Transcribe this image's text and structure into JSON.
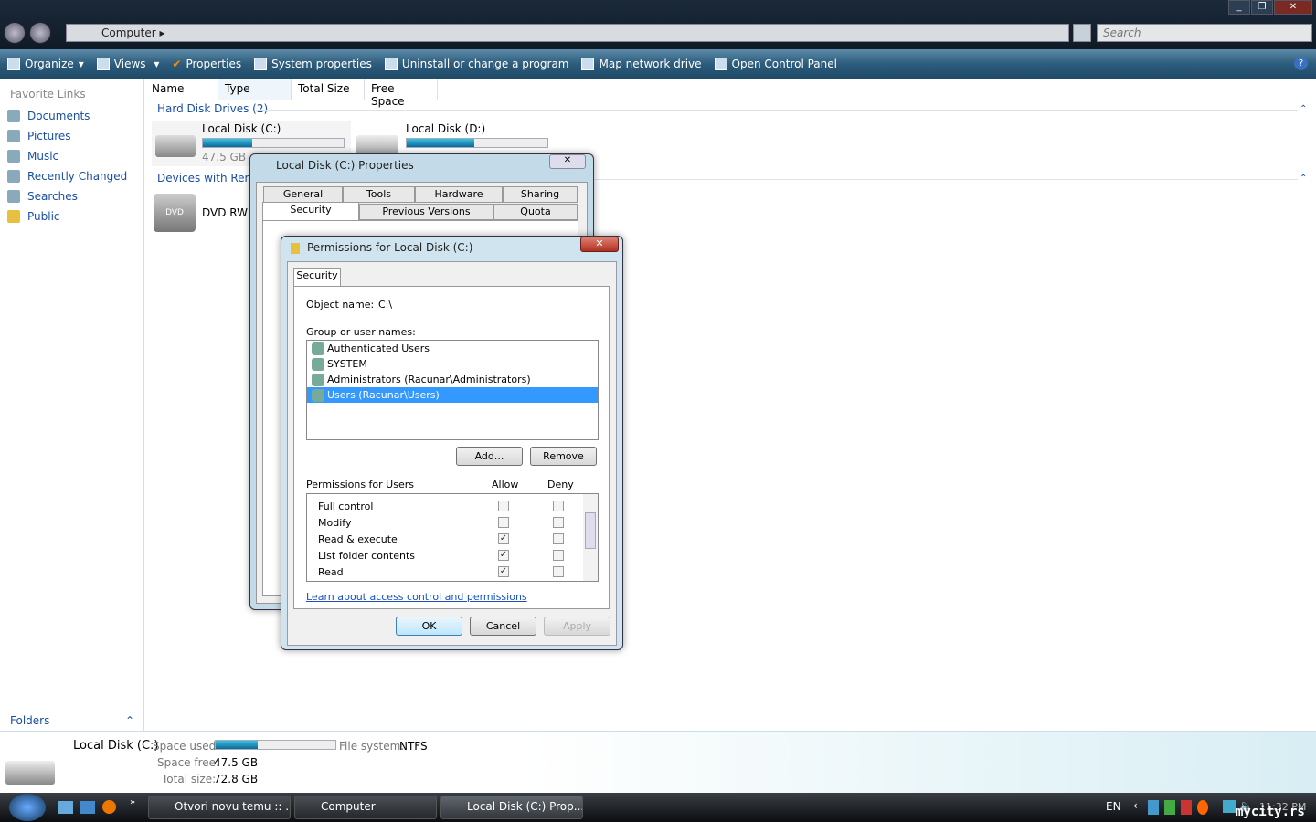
{
  "window": {
    "address": "Computer",
    "search_placeholder": "Search"
  },
  "toolbar": [
    "Organize",
    "Views",
    "Properties",
    "System properties",
    "Uninstall or change a program",
    "Map network drive",
    "Open Control Panel"
  ],
  "sidebar": {
    "header": "Favorite Links",
    "items": [
      "Documents",
      "Pictures",
      "Music",
      "Recently Changed",
      "Searches",
      "Public"
    ],
    "folders": "Folders"
  },
  "columns": [
    "Name",
    "Type",
    "Total Size",
    "Free Space"
  ],
  "groups": {
    "hdd": "Hard Disk Drives (2)",
    "removable": "Devices with Removable Storage"
  },
  "drives": [
    {
      "name": "Local Disk (C:)",
      "free": "47.5 GB free",
      "used_pct": 35
    },
    {
      "name": "Local Disk (D:)",
      "used_pct": 48
    }
  ],
  "dvd": "DVD RW Drive",
  "props": {
    "title": "Local Disk (C:) Properties",
    "tabs_row1": [
      "General",
      "Tools",
      "Hardware",
      "Sharing"
    ],
    "tabs_row2": [
      "Security",
      "Previous Versions",
      "Quota"
    ]
  },
  "perm": {
    "title": "Permissions for Local Disk (C:)",
    "tab": "Security",
    "object_label": "Object name:",
    "object_value": "C:\\",
    "group_label": "Group or user names:",
    "users": [
      "Authenticated Users",
      "SYSTEM",
      "Administrators (Racunar\\Administrators)",
      "Users (Racunar\\Users)"
    ],
    "add": "Add...",
    "remove": "Remove",
    "perm_label": "Permissions for Users",
    "allow": "Allow",
    "deny": "Deny",
    "perms": [
      {
        "name": "Full control",
        "allow": false,
        "deny": false
      },
      {
        "name": "Modify",
        "allow": false,
        "deny": false
      },
      {
        "name": "Read & execute",
        "allow": true,
        "deny": false
      },
      {
        "name": "List folder contents",
        "allow": true,
        "deny": false
      },
      {
        "name": "Read",
        "allow": true,
        "deny": false
      }
    ],
    "link": "Learn about access control and permissions",
    "ok": "OK",
    "cancel": "Cancel",
    "apply": "Apply"
  },
  "details": {
    "name": "Local Disk (C:)",
    "used_label": "Space used:",
    "used_pct": 35,
    "fs_label": "File system:",
    "fs": "NTFS",
    "free_label": "Space free:",
    "free": "47.5 GB",
    "total_label": "Total size:",
    "total": "72.8 GB"
  },
  "taskbar": {
    "tasks": [
      "Otvori novu temu :: ...",
      "Computer",
      "Local Disk (C:) Prop..."
    ],
    "lang": "EN",
    "clock": "11:32 PM",
    "watermark": "mycity.rs"
  }
}
